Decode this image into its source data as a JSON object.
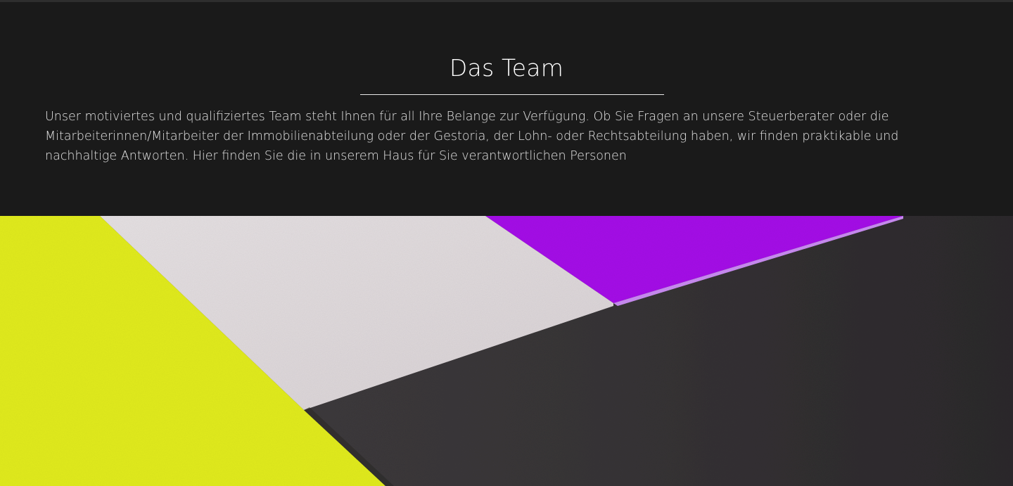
{
  "team": {
    "title": "Das Team",
    "intro": "Unser motiviertes und qualifiziertes Team steht Ihnen für all Ihre Belange zur Verfügung. Ob Sie Fragen an unsere Steuerberater oder die Mitarbeiterinnen/Mitarbeiter der Immobilienabteilung oder der Gestoria, der Lohn- oder Rechtsabteilung haben, wir finden praktikable und nachhaltige Antworten. Hier finden Sie die in unserem Haus für Sie verantwortlichen Personen"
  },
  "hero": {
    "colors": {
      "yellow": "#e2ec1e",
      "paper": "#e0dadc",
      "magenta": "#a50ee8",
      "magenta_edge": "#c98cf2",
      "dark": "#3a3838",
      "background": "#1a1a1a"
    }
  }
}
